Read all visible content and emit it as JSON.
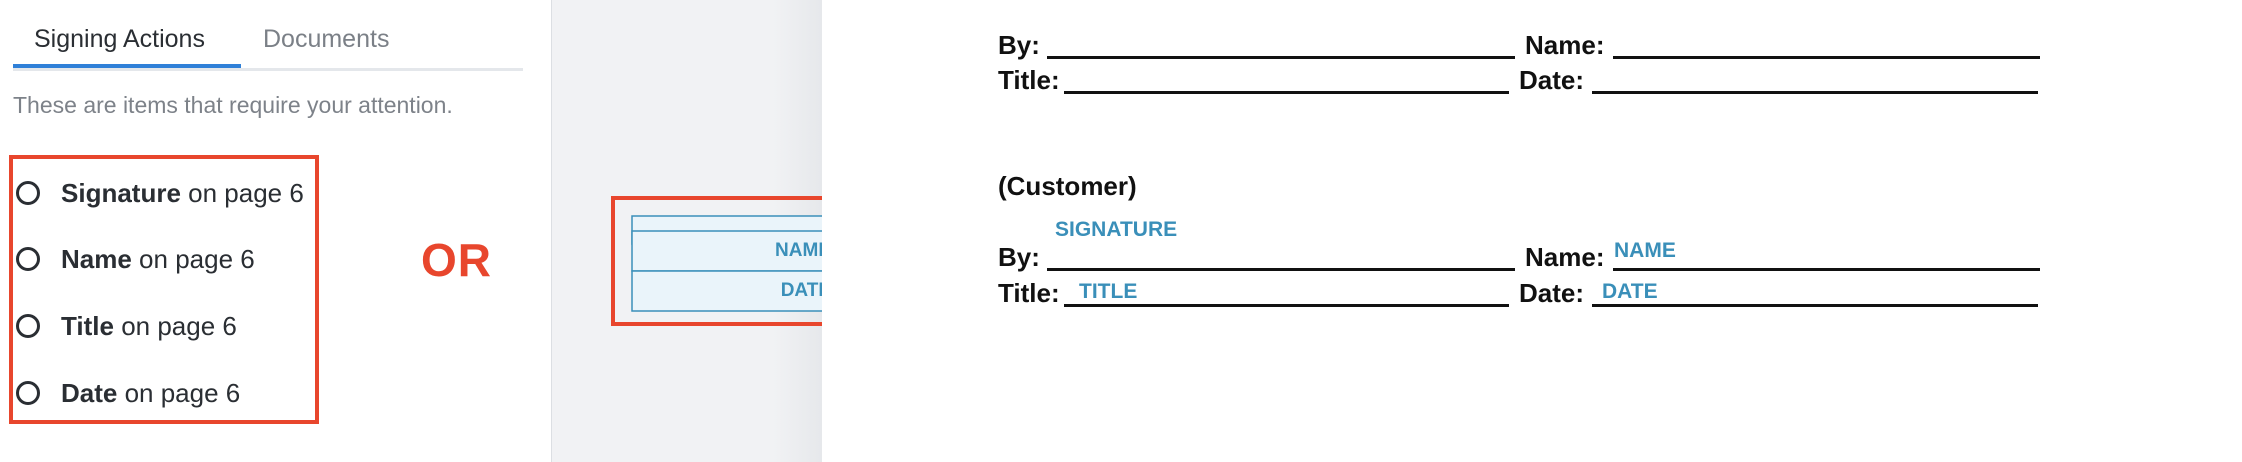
{
  "sidebar": {
    "tabs": [
      {
        "label": "Signing Actions"
      },
      {
        "label": "Documents"
      }
    ],
    "intro": "These are items that require your attention.",
    "actions": [
      {
        "bold": "Signature",
        "rest": " on page 6"
      },
      {
        "bold": "Name",
        "rest": " on page 6"
      },
      {
        "bold": "Title",
        "rest": " on page 6"
      },
      {
        "bold": "Date",
        "rest": " on page 6"
      }
    ]
  },
  "or_label": "OR",
  "tags": [
    {
      "label": ""
    },
    {
      "label": "NAME"
    },
    {
      "label": "DATE"
    }
  ],
  "document": {
    "block1": {
      "by": "By:",
      "name": "Name:",
      "title": "Title:",
      "date": "Date:"
    },
    "customer_heading": "(Customer)",
    "block2": {
      "by": "By:",
      "name": "Name:",
      "title": "Title:",
      "date": "Date:"
    },
    "fields": {
      "signature": "SIGNATURE",
      "name": "NAME",
      "title": "TITLE",
      "date": "DATE"
    }
  },
  "colors": {
    "accent": "#2f80d8",
    "highlight": "#e8462d",
    "tag_text": "#3a8fb9",
    "tag_fill": "#eaf4fa"
  }
}
